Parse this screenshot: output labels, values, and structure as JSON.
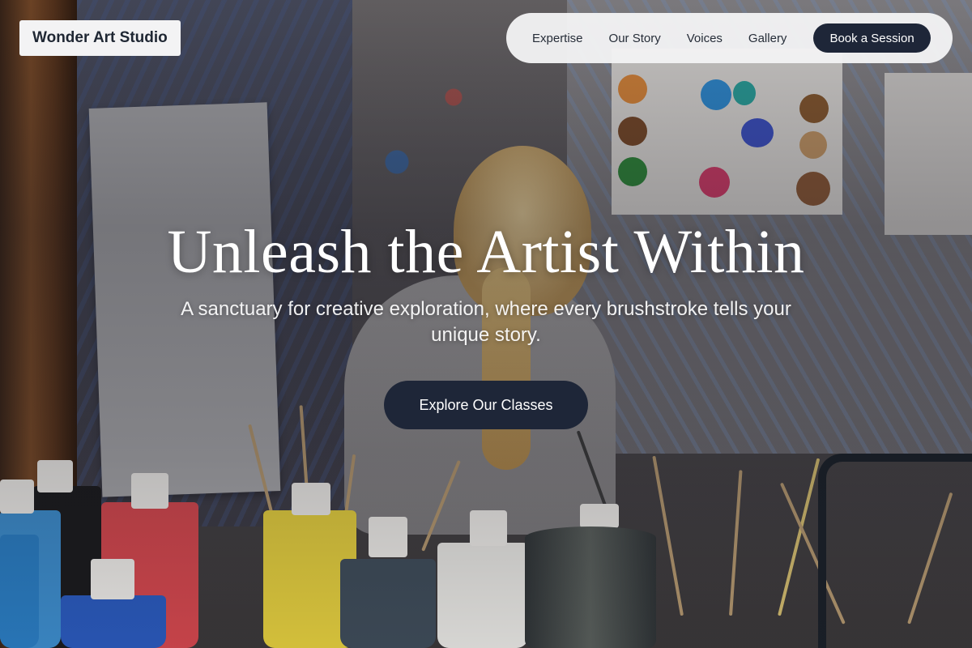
{
  "brand": {
    "name": "Wonder Art Studio"
  },
  "nav": {
    "links": [
      {
        "label": "Expertise"
      },
      {
        "label": "Our Story"
      },
      {
        "label": "Voices"
      },
      {
        "label": "Gallery"
      }
    ],
    "cta_label": "Book a Session"
  },
  "hero": {
    "title": "Unleash the Artist Within",
    "subtitle": "A sanctuary for creative exploration, where every brushstroke tells your unique story.",
    "cta_label": "Explore Our Classes",
    "background_image": "art studio with girl facing paint-splattered wall, paint bottles and brushes in foreground"
  },
  "colors": {
    "accent": "#1e2638",
    "nav_background": "#f3f3f4",
    "text_on_hero": "#ffffff"
  }
}
